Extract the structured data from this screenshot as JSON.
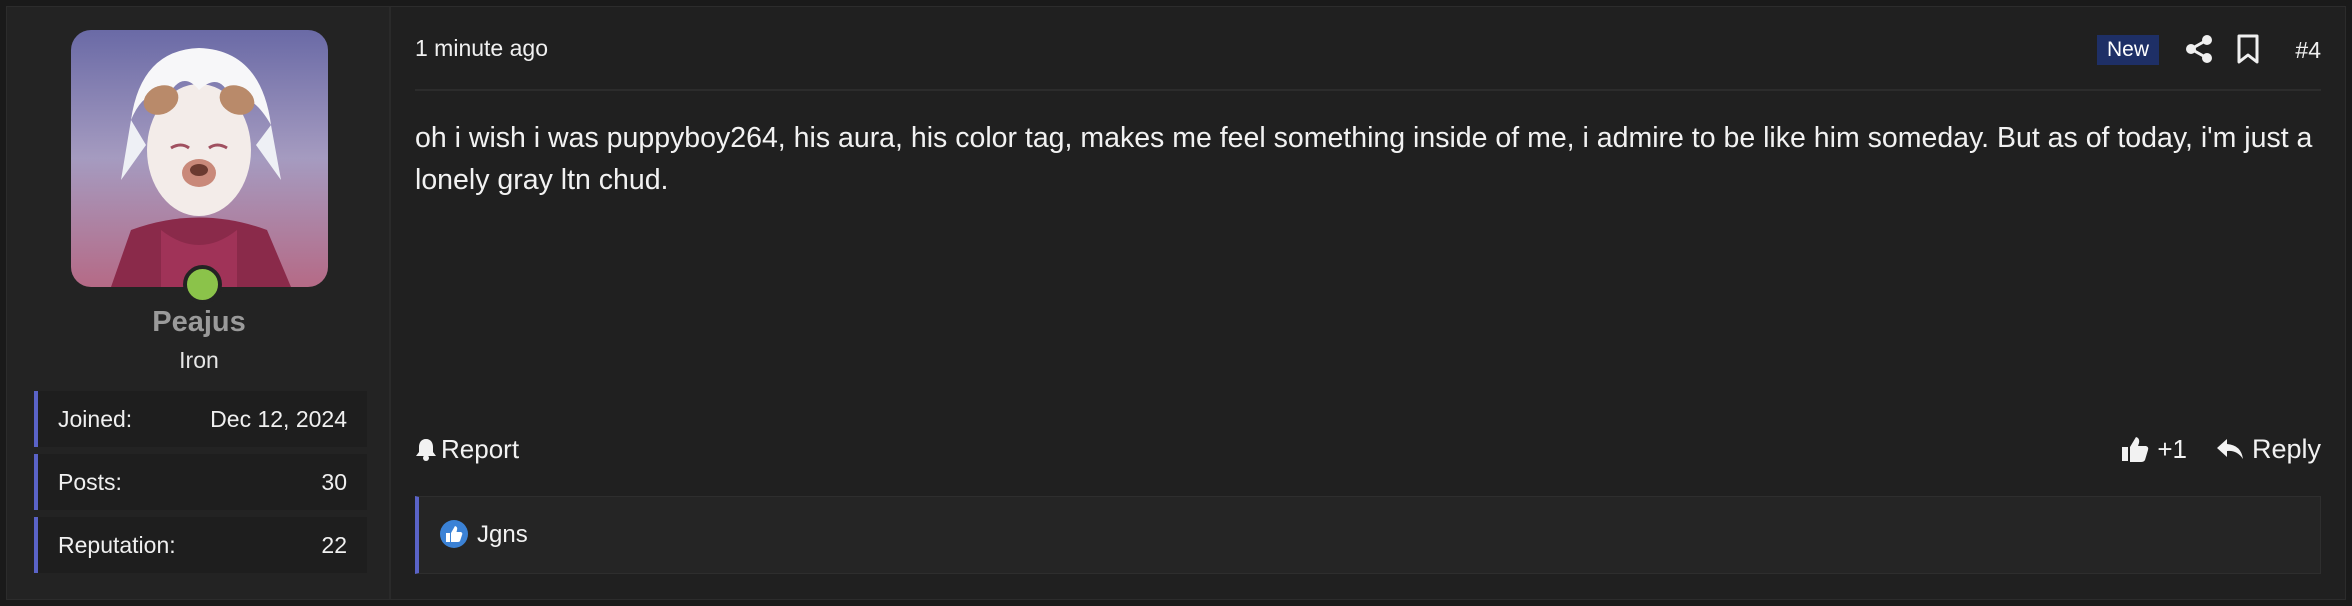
{
  "author": {
    "username": "Peajus",
    "rank": "Iron",
    "online": true,
    "online_color": "#8bc34a",
    "stats": [
      {
        "label": "Joined:",
        "value": "Dec 12, 2024"
      },
      {
        "label": "Posts:",
        "value": "30"
      },
      {
        "label": "Reputation:",
        "value": "22"
      }
    ]
  },
  "post": {
    "time": "1 minute ago",
    "badge": "New",
    "number": "#4",
    "message": "oh i wish i was puppyboy264, his aura, his color tag, makes me feel something inside of me, i admire to be like him someday. But as of today, i'm just a lonely gray ltn chud."
  },
  "actions": {
    "report_label": "Report",
    "like_label": "+1",
    "reply_label": "Reply"
  },
  "reactions": {
    "icon": "thumbs-up-icon",
    "users": [
      "Jgns"
    ]
  },
  "colors": {
    "accent": "#5a63c7",
    "badge_bg": "#1e2f66",
    "like_badge": "#3b82d6"
  }
}
